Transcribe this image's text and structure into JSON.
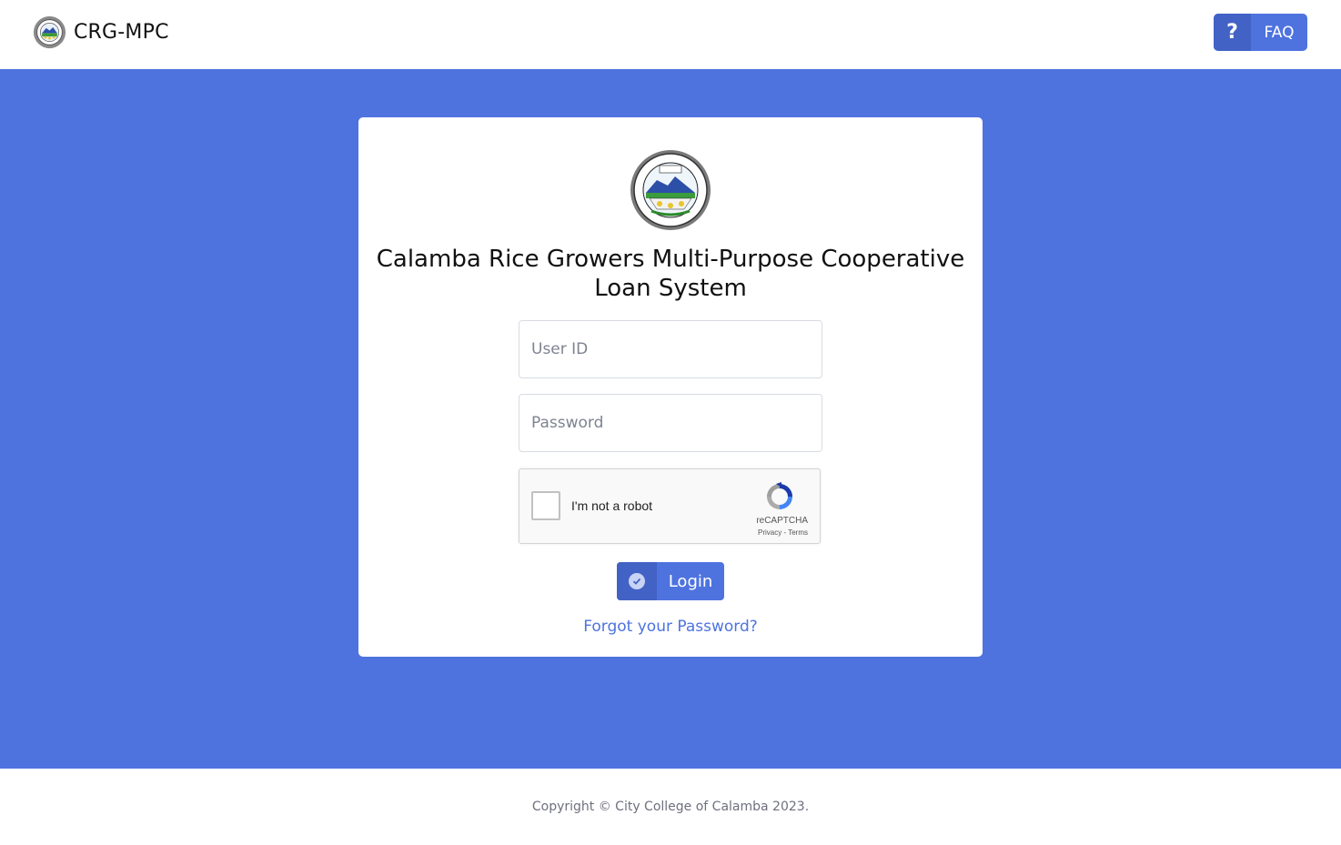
{
  "header": {
    "brand_name": "CRG-MPC",
    "faq_label": "FAQ",
    "faq_icon": "question-mark-icon"
  },
  "login": {
    "title": "Calamba Rice Growers Multi-Purpose Cooperative Loan System",
    "user_id_placeholder": "User ID",
    "password_placeholder": "Password",
    "captcha": {
      "label": "I'm not a robot",
      "brand": "reCAPTCHA",
      "privacy": "Privacy",
      "separator": " - ",
      "terms": "Terms"
    },
    "login_label": "Login",
    "forgot_label": "Forgot your Password?"
  },
  "footer": {
    "copyright": "Copyright © City College of Calamba 2023."
  },
  "colors": {
    "primary": "#4e73df",
    "primary_dark": "#4262c5",
    "page_bg": "#ffffff"
  }
}
